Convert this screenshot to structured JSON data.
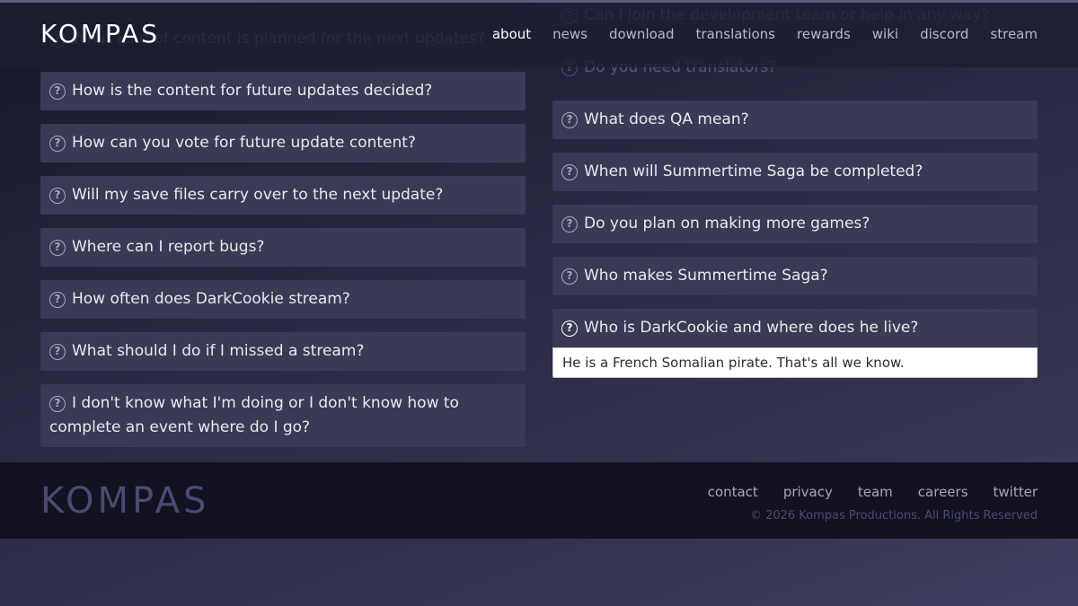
{
  "brand": {
    "logo": "KOMPAS"
  },
  "nav": [
    "about",
    "news",
    "download",
    "translations",
    "rewards",
    "wiki",
    "discord",
    "stream"
  ],
  "nav_current": "about",
  "faq_left": [
    {
      "q": "What kind of content is planned for the next updates?",
      "faded": true
    },
    {
      "q": "How is the content for future updates decided?"
    },
    {
      "q": "How can you vote for future update content?"
    },
    {
      "q": "Will my save files carry over to the next update?"
    },
    {
      "q": "Where can I report bugs?"
    },
    {
      "q": "How often does DarkCookie stream?"
    },
    {
      "q": "What should I do if I missed a stream?"
    },
    {
      "q": "I don't know what I'm doing or I don't know how to complete an event where do I go?"
    }
  ],
  "faq_right": [
    {
      "q": "Can I join the development team or help in any way?",
      "faded": true
    },
    {
      "q": "Do you need translators?",
      "faded": true
    },
    {
      "q": "What does QA mean?"
    },
    {
      "q": "When will Summertime Saga be completed?"
    },
    {
      "q": "Do you plan on making more games?"
    },
    {
      "q": "Who makes Summertime Saga?"
    },
    {
      "q": "Who is DarkCookie and where does he live?",
      "active": true,
      "answer": "He is a French Somalian pirate. That's all we know."
    }
  ],
  "footer": {
    "logo": "KOMPAS",
    "links": [
      "contact",
      "privacy",
      "team",
      "careers",
      "twitter"
    ],
    "copyright": "© 2026 Kompas Productions. All Rights Reserved"
  }
}
